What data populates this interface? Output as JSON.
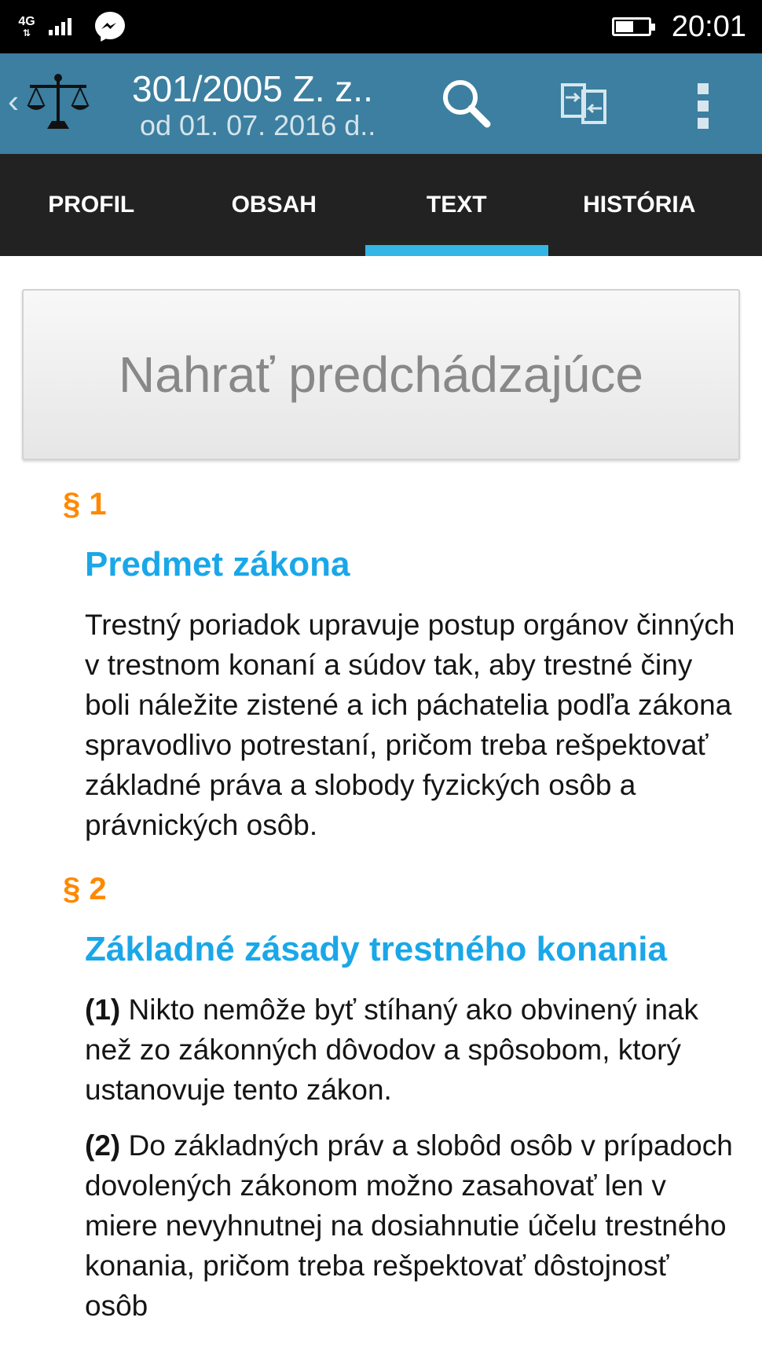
{
  "status_bar": {
    "network": "4G",
    "clock": "20:01",
    "icons": [
      "signal-bars-icon",
      "messenger-icon",
      "battery-icon"
    ]
  },
  "app_bar": {
    "title": "301/2005 Z. z..",
    "subtitle": "od 01. 07. 2016 d..",
    "icons": [
      "scales-of-justice-icon",
      "search-icon",
      "compare-icon",
      "overflow-menu-icon"
    ]
  },
  "tabs": [
    {
      "label": "PROFIL",
      "active": false
    },
    {
      "label": "OBSAH",
      "active": false
    },
    {
      "label": "TEXT",
      "active": true
    },
    {
      "label": "HISTÓRIA",
      "active": false
    }
  ],
  "load_previous_label": "Nahrať predchádzajúce",
  "sections": [
    {
      "number": "§ 1",
      "title": "Predmet zákona",
      "paragraphs": [
        {
          "num": "",
          "text": "Trestný poriadok upravuje postup orgánov činných v trestnom konaní a súdov tak, aby trestné činy boli náležite zistené a ich páchatelia podľa zákona spravodlivo potrestaní, pričom treba rešpektovať základné práva a slobody fyzických osôb a právnických osôb."
        }
      ]
    },
    {
      "number": "§ 2",
      "title": "Základné zásady trestného konania",
      "paragraphs": [
        {
          "num": "(1)",
          "text": "Nikto nemôže byť stíhaný ako obvinený inak než zo zákonných dôvodov a spôsobom, ktorý ustanovuje tento zákon."
        },
        {
          "num": "(2)",
          "text": "Do základných práv a slobôd osôb v prípadoch dovolených zákonom možno zasahovať len v miere nevyhnutnej na dosiahnutie účelu trestného konania, pričom treba rešpektovať dôstojnosť osôb"
        }
      ]
    }
  ],
  "colors": {
    "app_bar": "#3c7fa0",
    "tab_bar": "#222222",
    "tab_indicator": "#33b5e5",
    "section_number": "#ff8800",
    "section_title": "#1aa7e8"
  }
}
